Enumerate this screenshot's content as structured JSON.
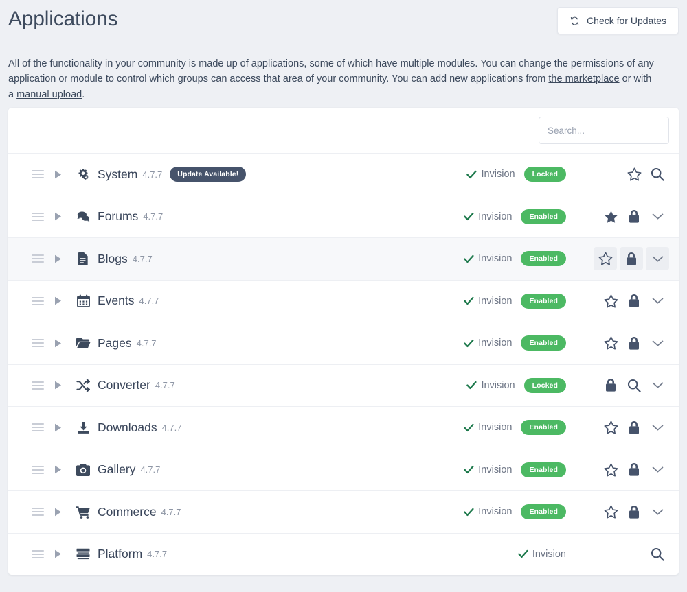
{
  "header": {
    "title": "Applications",
    "check_updates_label": "Check for Updates",
    "check_updates_icon": "refresh-icon"
  },
  "intro": {
    "part1": "All of the functionality in your community is made up of applications, some of which have multiple modules. You can change the permissions of any application or module to control which groups can access that area of your community. You can add new applications from ",
    "link_marketplace": "the marketplace",
    "part2": " or with a ",
    "link_manual_upload": "manual upload",
    "part3": "."
  },
  "search": {
    "placeholder": "Search...",
    "value": ""
  },
  "colors": {
    "page_bg": "#eef0f4",
    "card_bg": "#ffffff",
    "text": "#3d4a5d",
    "enabled_badge": "#4cb963",
    "locked_badge": "#4cb963",
    "update_badge": "#46536b",
    "author_check": "#1f7a4d",
    "row_hover": "#f7f8fa"
  },
  "applications": [
    {
      "name": "System",
      "version": "4.7.7",
      "icon": "gears-icon",
      "update_badge": "Update Available!",
      "author": "Invision",
      "status": "Locked",
      "hovered": false,
      "actions": [
        "star-outline-icon",
        "search-icon"
      ]
    },
    {
      "name": "Forums",
      "version": "4.7.7",
      "icon": "comments-icon",
      "update_badge": null,
      "author": "Invision",
      "status": "Enabled",
      "hovered": false,
      "actions": [
        "star-filled-icon",
        "lock-icon",
        "chevron-down-icon"
      ]
    },
    {
      "name": "Blogs",
      "version": "4.7.7",
      "icon": "file-text-icon",
      "update_badge": null,
      "author": "Invision",
      "status": "Enabled",
      "hovered": true,
      "actions": [
        "star-outline-icon",
        "lock-icon",
        "chevron-down-icon"
      ]
    },
    {
      "name": "Events",
      "version": "4.7.7",
      "icon": "calendar-icon",
      "update_badge": null,
      "author": "Invision",
      "status": "Enabled",
      "hovered": false,
      "actions": [
        "star-outline-icon",
        "lock-icon",
        "chevron-down-icon"
      ]
    },
    {
      "name": "Pages",
      "version": "4.7.7",
      "icon": "folder-open-icon",
      "update_badge": null,
      "author": "Invision",
      "status": "Enabled",
      "hovered": false,
      "actions": [
        "star-outline-icon",
        "lock-icon",
        "chevron-down-icon"
      ]
    },
    {
      "name": "Converter",
      "version": "4.7.7",
      "icon": "shuffle-icon",
      "update_badge": null,
      "author": "Invision",
      "status": "Locked",
      "hovered": false,
      "actions": [
        "lock-icon",
        "search-icon",
        "chevron-down-icon"
      ]
    },
    {
      "name": "Downloads",
      "version": "4.7.7",
      "icon": "download-icon",
      "update_badge": null,
      "author": "Invision",
      "status": "Enabled",
      "hovered": false,
      "actions": [
        "star-outline-icon",
        "lock-icon",
        "chevron-down-icon"
      ]
    },
    {
      "name": "Gallery",
      "version": "4.7.7",
      "icon": "camera-icon",
      "update_badge": null,
      "author": "Invision",
      "status": "Enabled",
      "hovered": false,
      "actions": [
        "star-outline-icon",
        "lock-icon",
        "chevron-down-icon"
      ]
    },
    {
      "name": "Commerce",
      "version": "4.7.7",
      "icon": "shopping-cart-icon",
      "update_badge": null,
      "author": "Invision",
      "status": "Enabled",
      "hovered": false,
      "actions": [
        "star-outline-icon",
        "lock-icon",
        "chevron-down-icon"
      ]
    },
    {
      "name": "Platform",
      "version": "4.7.7",
      "icon": "server-icon",
      "update_badge": null,
      "author": "Invision",
      "status": null,
      "hovered": false,
      "actions": [
        "search-icon"
      ]
    }
  ]
}
